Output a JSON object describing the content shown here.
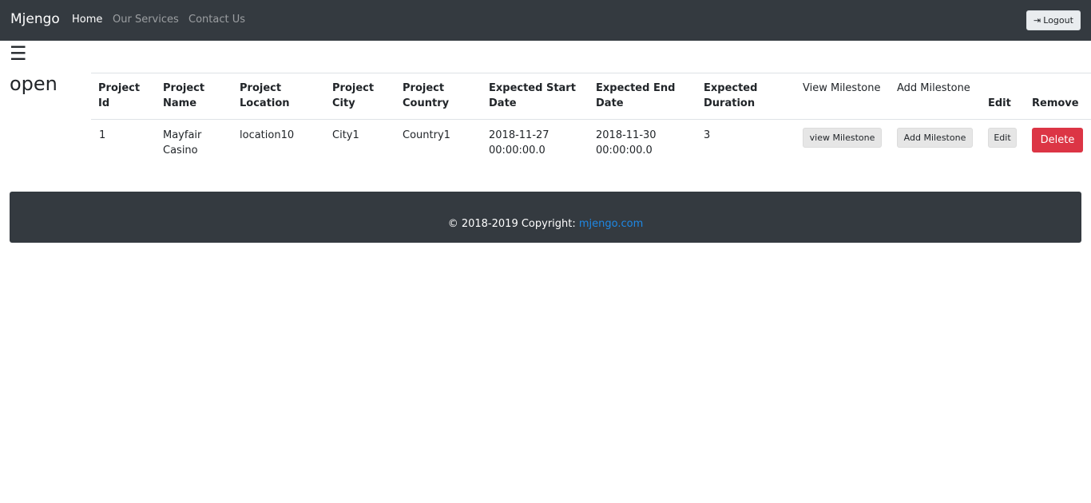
{
  "navbar": {
    "brand": "Mjengo",
    "links": [
      {
        "label": "Home",
        "active": true
      },
      {
        "label": "Our Services",
        "active": false
      },
      {
        "label": "Contact Us",
        "active": false
      }
    ],
    "logout_label": "Logout",
    "logout_icon": "sign-in-icon"
  },
  "sidebar": {
    "toggle_glyph": "☰",
    "toggle_text": "open"
  },
  "table": {
    "headers": {
      "project_id": [
        "Project",
        "Id"
      ],
      "project_name": [
        "Project",
        "Name"
      ],
      "project_location": [
        "Project",
        "Location"
      ],
      "project_city": [
        "Project",
        "City"
      ],
      "project_country": [
        "Project",
        "Country"
      ],
      "expected_start": [
        "Expected Start",
        "Date"
      ],
      "expected_end": [
        "Expected End",
        "Date"
      ],
      "expected_duration": [
        "Expected",
        "Duration"
      ],
      "view_milestone": "View Milestone",
      "add_milestone": "Add Milestone",
      "edit": "Edit",
      "remove": "Remove"
    },
    "rows": [
      {
        "id": "1",
        "name": [
          "Mayfair",
          "Casino"
        ],
        "location": "location10",
        "city": "City1",
        "country": "Country1",
        "start": [
          "2018-11-27",
          "00:00:00.0"
        ],
        "end": [
          "2018-11-30",
          "00:00:00.0"
        ],
        "duration": "3",
        "view_btn": "view Milestone",
        "add_btn": "Add Milestone",
        "edit_btn": "Edit",
        "delete_btn": "Delete"
      }
    ]
  },
  "footer": {
    "copyright": "© 2018-2019 Copyright:",
    "link": "mjengo.com"
  },
  "colors": {
    "navbar_bg": "#343a40",
    "danger": "#dc3545",
    "link": "#1e88e5"
  }
}
